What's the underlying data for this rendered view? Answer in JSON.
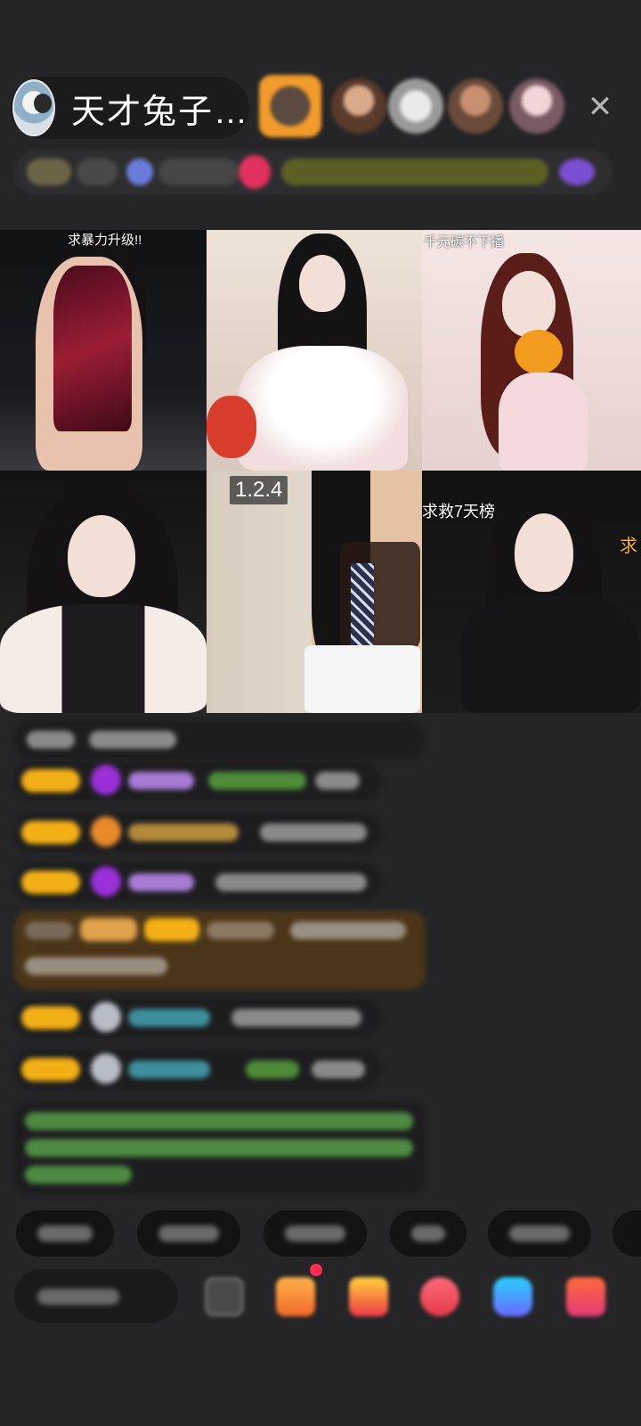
{
  "host": {
    "name": "天才兔子…",
    "avatar_icon": "host-avatar"
  },
  "viewers": [
    "viewer-avatar",
    "viewer-avatar",
    "viewer-avatar",
    "viewer-avatar",
    "viewer-avatar"
  ],
  "close_icon": "close-icon",
  "close_glyph": "✕",
  "video_tiles": [
    {
      "caption": "求暴力升级!!"
    },
    {
      "caption": ""
    },
    {
      "caption": "千元碳不下播"
    },
    {
      "caption": ""
    },
    {
      "caption": "",
      "number_badge": "1.2.4"
    },
    {
      "caption": "求救7天榜",
      "side_caption": "求"
    }
  ],
  "colors": {
    "background": "#252527",
    "level_badge": "#f3b016",
    "gift_highlight": "#4b3518",
    "system_text": "#5bb15b",
    "notification_dot": "#ff2d4f"
  }
}
